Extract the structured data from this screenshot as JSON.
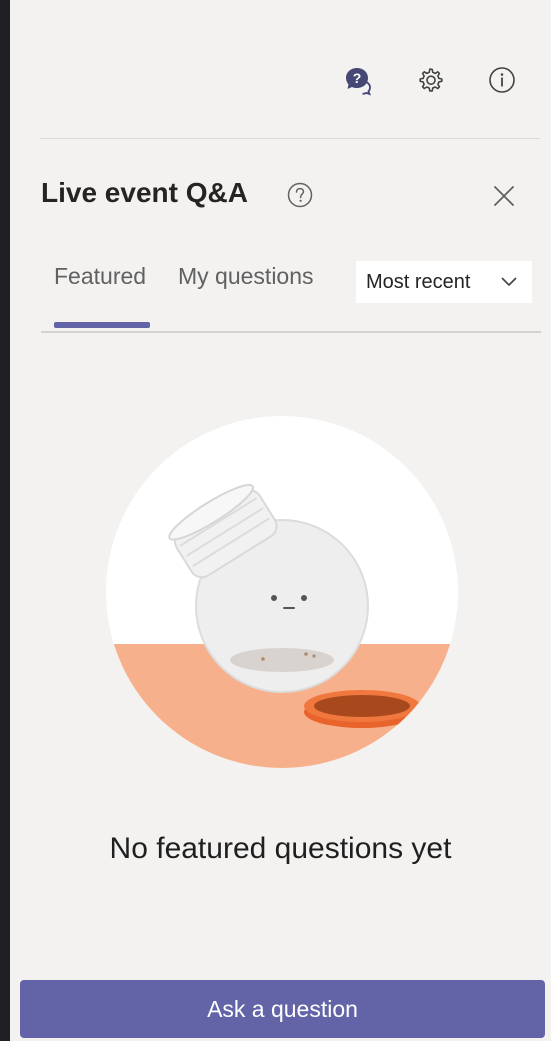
{
  "toolbar": {
    "qa_icon": "qa-icon",
    "settings_icon": "gear-icon",
    "info_icon": "info-icon"
  },
  "header": {
    "title": "Live event Q&A",
    "help_icon": "help-icon",
    "close_icon": "close-icon"
  },
  "tabs": [
    {
      "label": "Featured",
      "selected": true
    },
    {
      "label": "My questions",
      "selected": false
    }
  ],
  "sort": {
    "selected": "Most recent"
  },
  "empty_state": {
    "message": "No featured questions yet"
  },
  "actions": {
    "ask_label": "Ask a question"
  },
  "colors": {
    "accent": "#6264a7",
    "background": "#f3f2f1",
    "illustration_orange": "#f7b08c",
    "lid_orange": "#e8642c"
  }
}
